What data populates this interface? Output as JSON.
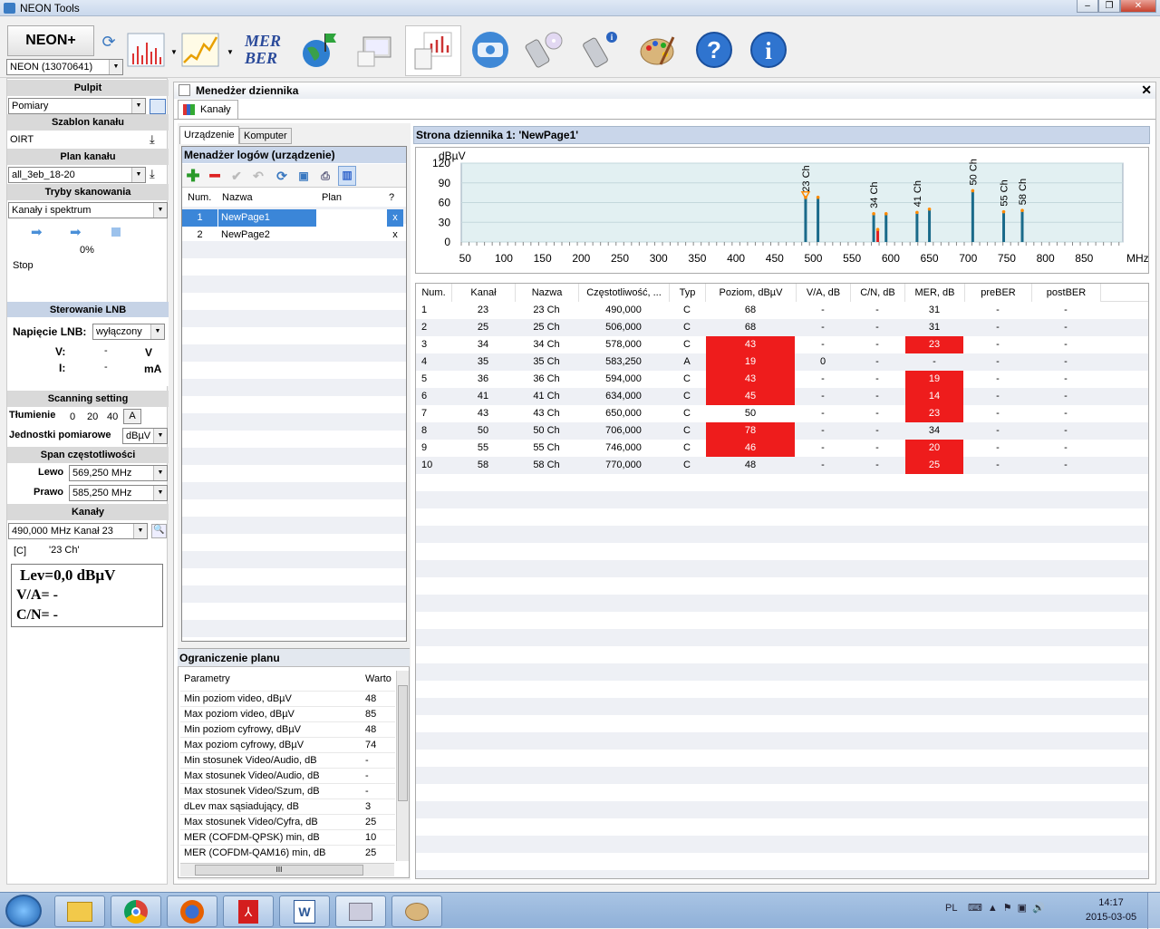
{
  "app": {
    "title": "NEON Tools"
  },
  "toolbar": {
    "device_button": "NEON+",
    "device_select": "NEON (13070641)",
    "mer_label": "MER",
    "ber_label": "BER"
  },
  "left": {
    "pulpit_header": "Pulpit",
    "pulpit_value": "Pomiary",
    "template_header": "Szablon kanału",
    "template_value": "OIRT",
    "plan_header": "Plan kanału",
    "plan_value": "all_3eb_18-20",
    "scan_header": "Tryby skanowania",
    "scan_value": "Kanały i spektrum",
    "progress": "0%",
    "status": "Stop",
    "lnb_header": "Sterowanie LNB",
    "lnb_voltage_label": "Napięcie LNB:",
    "lnb_voltage_value": "wyłączony",
    "v_label": "V:",
    "v_value": "-",
    "v_unit": "V",
    "i_label": "I:",
    "i_value": "-",
    "i_unit": "mA",
    "scanning_header": "Scanning setting",
    "attn_label": "Tłumienie",
    "attn_options": [
      "0",
      "20",
      "40"
    ],
    "attn_btn": "A",
    "units_label": "Jednostki pomiarowe",
    "units_value": "dBµV",
    "span_header": "Span częstotliwości",
    "left_label": "Lewo",
    "left_value": "569,250 MHz",
    "right_label": "Prawo",
    "right_value": "585,250 MHz",
    "channels_header": "Kanały",
    "channel_value": "490,000 MHz  Kanał 23",
    "ch_type": "[C]",
    "ch_name": "'23 Ch'",
    "lev": "Lev=0,0 dBµV",
    "va": "V/A= -",
    "cn": "C/N= -"
  },
  "manager": {
    "title": "Menedżer dziennika",
    "tab_channels": "Kanały",
    "tab_device": "Urządzenie",
    "tab_computer": "Komputer",
    "log_manager_title": "Menadżer logów (urządzenie)",
    "log_columns": [
      "Num.",
      "Nazwa",
      "Plan",
      "?"
    ],
    "logs": [
      {
        "num": "1",
        "name": "NewPage1",
        "plan": "",
        "x": "x"
      },
      {
        "num": "2",
        "name": "NewPage2",
        "plan": "",
        "x": "x"
      }
    ],
    "plan_title": "Ograniczenie planu",
    "plan_columns": [
      "Parametry",
      "Warto"
    ],
    "plan_rows": [
      {
        "p": "Min poziom video, dBµV",
        "v": "48"
      },
      {
        "p": "Max poziom video, dBµV",
        "v": "85"
      },
      {
        "p": "Min poziom cyfrowy, dBµV",
        "v": "48"
      },
      {
        "p": "Max poziom cyfrowy, dBµV",
        "v": "74"
      },
      {
        "p": "Min stosunek Video/Audio, dB",
        "v": "-"
      },
      {
        "p": "Max stosunek Video/Audio, dB",
        "v": "-"
      },
      {
        "p": "Max stosunek Video/Szum, dB",
        "v": "-"
      },
      {
        "p": "dLev max sąsiadujący, dB",
        "v": "3"
      },
      {
        "p": "Max stosunek Video/Cyfra, dB",
        "v": "25"
      },
      {
        "p": "MER (COFDM-QPSK) min, dB",
        "v": "10"
      },
      {
        "p": "MER (COFDM-QAM16) min, dB",
        "v": "25"
      }
    ],
    "hscroll_label": "III"
  },
  "page": {
    "title": "Strona dziennika 1: 'NewPage1'",
    "columns": [
      "Num.",
      "Kanał",
      "Nazwa",
      "Częstotliwość, ...",
      "Typ",
      "Poziom, dBµV",
      "V/A, dB",
      "C/N, dB",
      "MER, dB",
      "preBER",
      "postBER"
    ],
    "rows": [
      {
        "num": "1",
        "ch": "23",
        "name": "23 Ch",
        "freq": "490,000",
        "typ": "C",
        "lev": "68",
        "levRed": false,
        "va": "-",
        "cn": "-",
        "mer": "31",
        "merRed": false,
        "pre": "-",
        "post": "-"
      },
      {
        "num": "2",
        "ch": "25",
        "name": "25 Ch",
        "freq": "506,000",
        "typ": "C",
        "lev": "68",
        "levRed": false,
        "va": "-",
        "cn": "-",
        "mer": "31",
        "merRed": false,
        "pre": "-",
        "post": "-"
      },
      {
        "num": "3",
        "ch": "34",
        "name": "34 Ch",
        "freq": "578,000",
        "typ": "C",
        "lev": "43",
        "levRed": true,
        "va": "-",
        "cn": "-",
        "mer": "23",
        "merRed": true,
        "pre": "-",
        "post": "-"
      },
      {
        "num": "4",
        "ch": "35",
        "name": "35 Ch",
        "freq": "583,250",
        "typ": "A",
        "lev": "19",
        "levRed": true,
        "va": "0",
        "cn": "-",
        "mer": "-",
        "merRed": false,
        "pre": "-",
        "post": "-"
      },
      {
        "num": "5",
        "ch": "36",
        "name": "36 Ch",
        "freq": "594,000",
        "typ": "C",
        "lev": "43",
        "levRed": true,
        "va": "-",
        "cn": "-",
        "mer": "19",
        "merRed": true,
        "pre": "-",
        "post": "-"
      },
      {
        "num": "6",
        "ch": "41",
        "name": "41 Ch",
        "freq": "634,000",
        "typ": "C",
        "lev": "45",
        "levRed": true,
        "va": "-",
        "cn": "-",
        "mer": "14",
        "merRed": true,
        "pre": "-",
        "post": "-"
      },
      {
        "num": "7",
        "ch": "43",
        "name": "43 Ch",
        "freq": "650,000",
        "typ": "C",
        "lev": "50",
        "levRed": false,
        "va": "-",
        "cn": "-",
        "mer": "23",
        "merRed": true,
        "pre": "-",
        "post": "-"
      },
      {
        "num": "8",
        "ch": "50",
        "name": "50 Ch",
        "freq": "706,000",
        "typ": "C",
        "lev": "78",
        "levRed": true,
        "va": "-",
        "cn": "-",
        "mer": "34",
        "merRed": false,
        "pre": "-",
        "post": "-"
      },
      {
        "num": "9",
        "ch": "55",
        "name": "55 Ch",
        "freq": "746,000",
        "typ": "C",
        "lev": "46",
        "levRed": true,
        "va": "-",
        "cn": "-",
        "mer": "20",
        "merRed": true,
        "pre": "-",
        "post": "-"
      },
      {
        "num": "10",
        "ch": "58",
        "name": "58 Ch",
        "freq": "770,000",
        "typ": "C",
        "lev": "48",
        "levRed": false,
        "va": "-",
        "cn": "-",
        "mer": "25",
        "merRed": true,
        "pre": "-",
        "post": "-"
      }
    ]
  },
  "chart_data": {
    "type": "bar",
    "ylabel": "dBµV",
    "xlabel": "MHz",
    "xlim": [
      45,
      900
    ],
    "ylim": [
      0,
      120
    ],
    "xticks": [
      50,
      100,
      150,
      200,
      250,
      300,
      350,
      400,
      450,
      500,
      550,
      600,
      650,
      700,
      750,
      800,
      850
    ],
    "yticks": [
      0,
      30,
      60,
      90,
      120
    ],
    "series": [
      {
        "x": 490,
        "y": 68,
        "label": "23 Ch"
      },
      {
        "x": 506,
        "y": 68,
        "label": ""
      },
      {
        "x": 578,
        "y": 43,
        "label": "34 Ch"
      },
      {
        "x": 583.25,
        "y": 19,
        "label": ""
      },
      {
        "x": 594,
        "y": 43,
        "label": ""
      },
      {
        "x": 634,
        "y": 45,
        "label": "41 Ch"
      },
      {
        "x": 650,
        "y": 50,
        "label": ""
      },
      {
        "x": 706,
        "y": 78,
        "label": "50 Ch"
      },
      {
        "x": 746,
        "y": 46,
        "label": "55 Ch"
      },
      {
        "x": 770,
        "y": 48,
        "label": "58 Ch"
      }
    ],
    "colors": {
      "bar": "#1a6a8a",
      "bar_analog": "#e02020",
      "marker": "#ff8a00",
      "plot_bg": "#e2f0f2"
    }
  },
  "taskbar": {
    "lang": "PL",
    "time": "14:17",
    "date": "2015-03-05"
  }
}
